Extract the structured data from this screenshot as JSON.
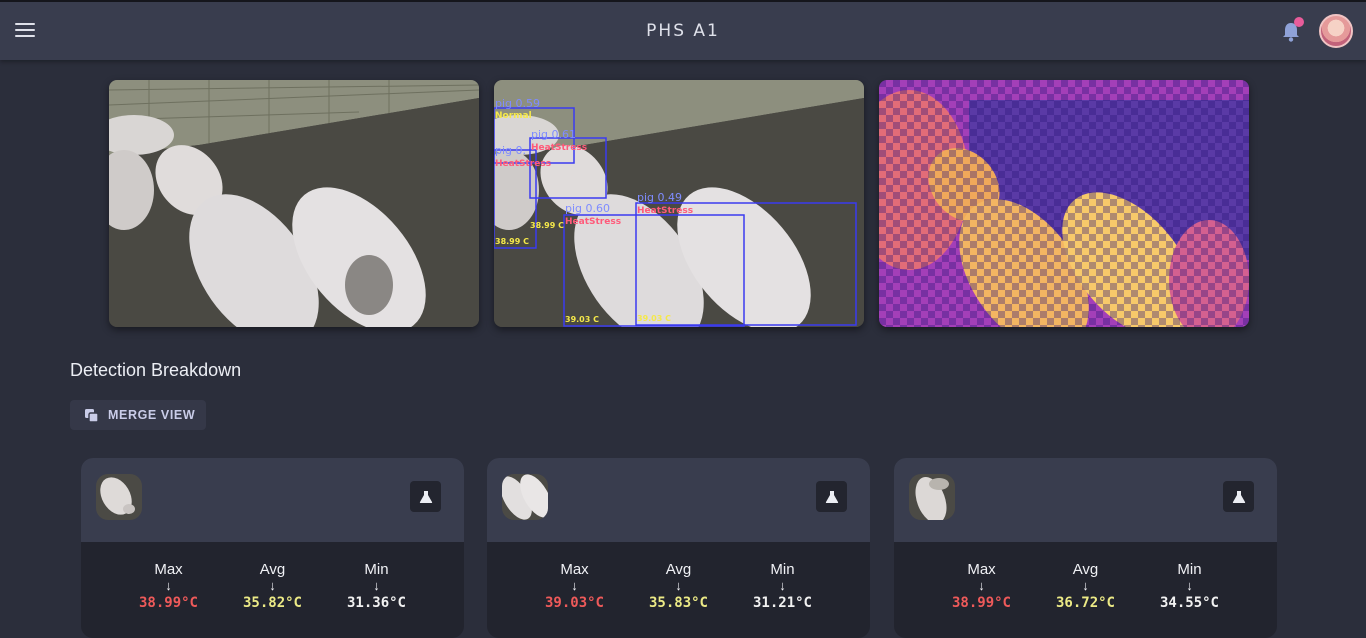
{
  "header": {
    "title": "PHS A1",
    "menu_icon": "hamburger-menu-icon",
    "bell_icon": "bell-icon",
    "avatar_icon": "user-avatar"
  },
  "images": [
    {
      "kind": "raw-camera"
    },
    {
      "kind": "detections",
      "detections": [
        {
          "label": "pig 0.59",
          "status": "Normal",
          "temp": "38.99 C"
        },
        {
          "label": "pig 0.61",
          "status": "HeatStress",
          "temp": "38.99 C"
        },
        {
          "label": "pig 0.",
          "status": "HeatStress",
          "temp": "38.99 C"
        },
        {
          "label": "pig 0.60",
          "status": "HeatStress",
          "temp": "39.03 C"
        },
        {
          "label": "pig 0.49",
          "status": "HeatStress",
          "temp": "39.03 C"
        }
      ]
    },
    {
      "kind": "thermal-overlay"
    }
  ],
  "breakdown": {
    "title": "Detection Breakdown",
    "merge_label": "MERGE VIEW",
    "colors": {
      "max": "#ef5a5a",
      "avg": "#ecea86",
      "min": "#f2f2f2"
    },
    "cards": [
      {
        "max_label": "Max",
        "avg_label": "Avg",
        "min_label": "Min",
        "arrow": "↓",
        "max": "38.99°C",
        "avg": "35.82°C",
        "min": "31.36°C"
      },
      {
        "max_label": "Max",
        "avg_label": "Avg",
        "min_label": "Min",
        "arrow": "↓",
        "max": "39.03°C",
        "avg": "35.83°C",
        "min": "31.21°C"
      },
      {
        "max_label": "Max",
        "avg_label": "Avg",
        "min_label": "Min",
        "arrow": "↓",
        "max": "38.99°C",
        "avg": "36.72°C",
        "min": "34.55°C"
      }
    ]
  }
}
